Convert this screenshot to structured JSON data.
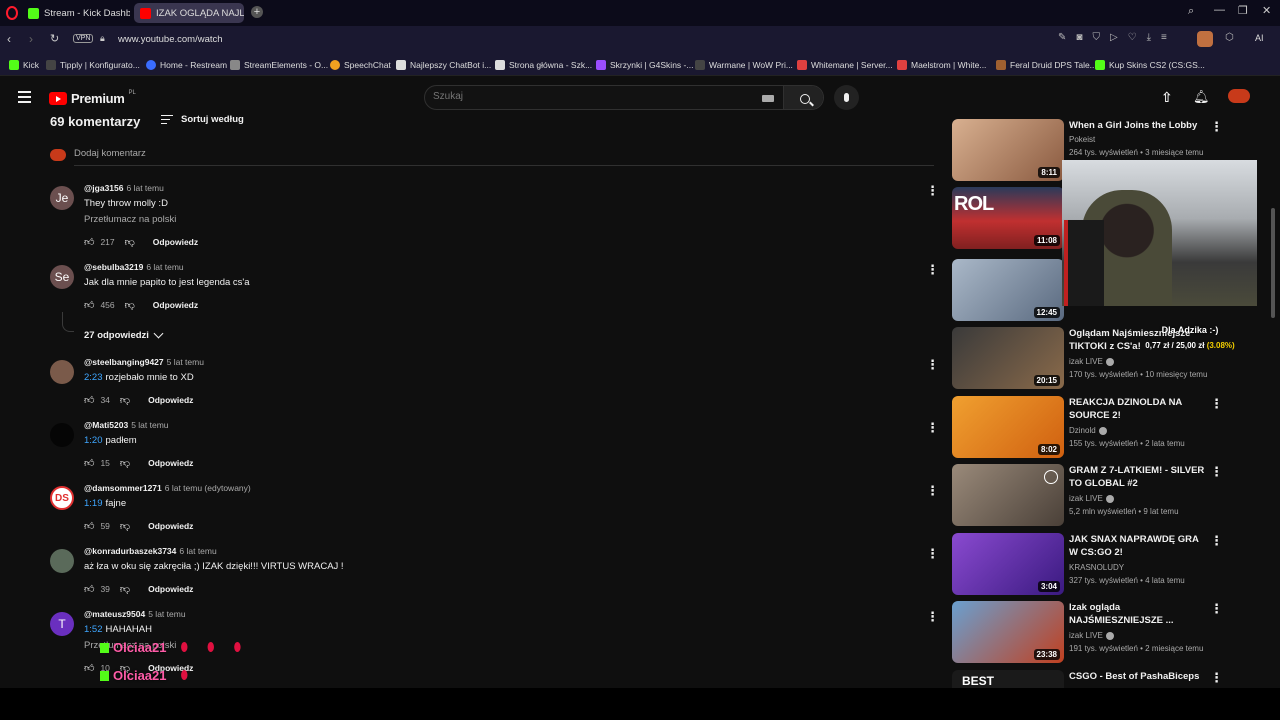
{
  "browser": {
    "tabs": [
      {
        "label": "Stream - Kick Dashboard",
        "color": "#53fc18",
        "active": false
      },
      {
        "label": "IZAK OGLĄDA NAJLEPSZE",
        "color": "#ff0000",
        "active": true
      }
    ],
    "url": "www.youtube.com/watch",
    "vpn_label": "VPN",
    "ai_label": "AI",
    "bookmarks": [
      {
        "label": "Kick",
        "color": "#53fc18"
      },
      {
        "label": "Tipply | Konfigurato...",
        "color": "#444"
      },
      {
        "label": "Home - Restream",
        "color": "#3a6cff"
      },
      {
        "label": "StreamElements - O...",
        "color": "#888"
      },
      {
        "label": "SpeechChat",
        "color": "#f0a020"
      },
      {
        "label": "Najlepszy ChatBot i...",
        "color": "#ddd"
      },
      {
        "label": "Strona główna - Szk...",
        "color": "#ddd"
      },
      {
        "label": "Skrzynki | G4Skins -...",
        "color": "#9b4dff"
      },
      {
        "label": "Warmane | WoW Pri...",
        "color": "#444"
      },
      {
        "label": "Whitemane | Server...",
        "color": "#e04040"
      },
      {
        "label": "Maelstrom | White...",
        "color": "#e04040"
      },
      {
        "label": "Feral Druid DPS Tale...",
        "color": "#a06030"
      },
      {
        "label": "Kup Skins CS2 (CS:GS...",
        "color": "#53fc18"
      }
    ]
  },
  "youtube": {
    "logo_text": "Premium",
    "region": "PL",
    "search_placeholder": "Szukaj",
    "comments_count": "69 komentarzy",
    "sort_label": "Sortuj według",
    "add_comment": "Dodaj komentarz",
    "reply_label": "Odpowiedz",
    "comments": [
      {
        "user": "@jga3156",
        "time": "6 lat temu",
        "timestamp": "",
        "text": "They throw molly :D",
        "translate": "Przetłumacz na polski",
        "likes": "217",
        "avatar": "Je",
        "avatar_color": "#6b4f4f"
      },
      {
        "user": "@sebulba3219",
        "time": "6 lat temu",
        "timestamp": "",
        "text": "Jak dla mnie papito to jest legenda cs'a",
        "translate": "",
        "likes": "456",
        "avatar": "Se",
        "avatar_color": "#6b4f4f"
      },
      {
        "user": "@steelbanging9427",
        "time": "5 lat temu",
        "timestamp": "2:23",
        "text": "rozjebało mnie to XD",
        "translate": "",
        "likes": "34",
        "avatar": "",
        "avatar_color": "#7a5a4a"
      },
      {
        "user": "@Mati5203",
        "time": "5 lat temu",
        "timestamp": "1:20",
        "text": "padłem",
        "translate": "",
        "likes": "15",
        "avatar": "",
        "avatar_color": "#050505"
      },
      {
        "user": "@damsommer1271",
        "time": "6 lat temu (edytowany)",
        "timestamp": "1:19",
        "text": "fajne",
        "translate": "",
        "likes": "59",
        "avatar": "DS",
        "avatar_color": "#e03030"
      },
      {
        "user": "@konradurbaszek3734",
        "time": "6 lat temu",
        "timestamp": "",
        "text": "aż łza w oku się zakręciła ;) IZAK dzięki!!! VIRTUS WRACAJ !",
        "translate": "",
        "likes": "39",
        "avatar": "",
        "avatar_color": "#5a6a5a"
      },
      {
        "user": "@mateusz9504",
        "time": "5 lat temu",
        "timestamp": "1:52",
        "text": "HAHAHAH",
        "translate": "Przetłumacz na polski",
        "likes": "10",
        "avatar": "T",
        "avatar_color": "#6a2fbf"
      }
    ],
    "replies_toggle": "27 odpowiedzi",
    "sidebar": [
      {
        "title": "When a Girl Joins the Lobby",
        "channel": "Pokeist",
        "verified": false,
        "meta": "264 tys. wyświetleń • 3 miesiące temu",
        "duration": "8:11",
        "thumb": "#c8a080"
      },
      {
        "title": "",
        "channel": "",
        "verified": false,
        "meta": "",
        "duration": "11:08",
        "thumb": "#b03030"
      },
      {
        "title": "",
        "channel": "",
        "verified": false,
        "meta": "",
        "duration": "12:45",
        "thumb": "#8aa0b8"
      },
      {
        "title": "Oglądam Najśmieszniejsze TIKTOKI z CS'a!",
        "channel": "izak LIVE",
        "verified": true,
        "meta": "170 tys. wyświetleń • 10 miesięcy temu",
        "duration": "20:15",
        "thumb": "#6a4a3a"
      },
      {
        "title": "REAKCJA DZINOLDA NA SOURCE 2!",
        "channel": "Dzinold",
        "verified": true,
        "meta": "155 tys. wyświetleń • 2 lata temu",
        "duration": "8:02",
        "thumb": "#e88a1a"
      },
      {
        "title": "GRAM Z 7-LATKIEM! - SILVER TO GLOBAL #2",
        "channel": "izak LIVE",
        "verified": true,
        "meta": "5,2 mln wyświetleń • 9 lat temu",
        "duration": "",
        "thumb": "#7a6a5a"
      },
      {
        "title": "JAK SNAX NAPRAWDĘ GRA W CS:GO 2!",
        "channel": "KRASNOLUDY",
        "verified": false,
        "meta": "327 tys. wyświetleń • 4 lata temu",
        "duration": "3:04",
        "thumb": "#6a3ab0"
      },
      {
        "title": "Izak ogląda NAJŚMIESZNIEJSZE ...",
        "channel": "izak LIVE",
        "verified": true,
        "meta": "191 tys. wyświetleń • 2 miesiące temu",
        "duration": "23:38",
        "thumb": "#4a8ac0"
      },
      {
        "title": "CSGO - Best of PashaBiceps",
        "channel": "",
        "verified": false,
        "meta": "",
        "duration": "",
        "thumb": "#222222"
      }
    ]
  },
  "overlay": {
    "donation_title": "Dla Adzika :-)",
    "donation_amount": "0,77 zł / 25,00 zł",
    "donation_percent": "(3.08%)",
    "chat_user": "Olciaa21",
    "chat_user_2": "Olciaa21"
  }
}
